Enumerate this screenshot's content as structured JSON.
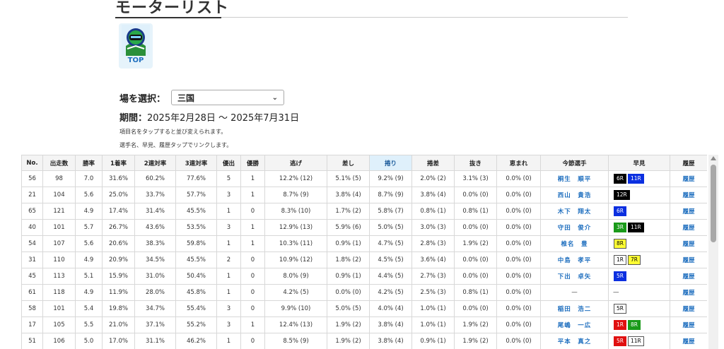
{
  "page": {
    "title": "モーターリスト"
  },
  "top_link": {
    "label": "TOP"
  },
  "venue": {
    "label": "場を選択：",
    "selected": "三国"
  },
  "period": {
    "label": "期間：",
    "value": "2025年2月28日 〜 2025年7月31日"
  },
  "notes": [
    "項目名をタップすると並び変えられます。",
    "選手名、早見、履歴タップでリンクします。"
  ],
  "table": {
    "headers": [
      "No.",
      "出走数",
      "勝率",
      "1着率",
      "2連対率",
      "3連対率",
      "優出",
      "優勝",
      "逃げ",
      "差し",
      "捲り",
      "捲差",
      "抜き",
      "恵まれ",
      "今節選手",
      "早見",
      "履歴"
    ],
    "active_header": "捲り",
    "rows": [
      {
        "no": "56",
        "starts": "98",
        "win": "7.0",
        "r1": "31.6%",
        "r2": "60.2%",
        "r3": "77.6%",
        "yu": "5",
        "yusho": "1",
        "nige": "12.2% (12)",
        "sashi": "5.1% (5)",
        "makuri": "9.2% (9)",
        "makusa": "2.0% (2)",
        "nuki": "3.1% (3)",
        "megu": "0.0% (0)",
        "racer": "桐生　順平",
        "haya": [
          {
            "t": "6R",
            "c": "black"
          },
          {
            "t": "11R",
            "c": "blue"
          }
        ],
        "hist": "履歴"
      },
      {
        "no": "21",
        "starts": "104",
        "win": "5.6",
        "r1": "25.0%",
        "r2": "33.7%",
        "r3": "57.7%",
        "yu": "3",
        "yusho": "1",
        "nige": "8.7% (9)",
        "sashi": "3.8% (4)",
        "makuri": "8.7% (9)",
        "makusa": "3.8% (4)",
        "nuki": "0.0% (0)",
        "megu": "0.0% (0)",
        "racer": "西山　貴浩",
        "haya": [
          {
            "t": "12R",
            "c": "black"
          }
        ],
        "hist": "履歴"
      },
      {
        "no": "65",
        "starts": "121",
        "win": "4.9",
        "r1": "17.4%",
        "r2": "31.4%",
        "r3": "45.5%",
        "yu": "1",
        "yusho": "0",
        "nige": "8.3% (10)",
        "sashi": "1.7% (2)",
        "makuri": "5.8% (7)",
        "makusa": "0.8% (1)",
        "nuki": "0.8% (1)",
        "megu": "0.0% (0)",
        "racer": "木下　翔太",
        "haya": [
          {
            "t": "6R",
            "c": "blue"
          }
        ],
        "hist": "履歴"
      },
      {
        "no": "40",
        "starts": "101",
        "win": "5.7",
        "r1": "26.7%",
        "r2": "43.6%",
        "r3": "53.5%",
        "yu": "3",
        "yusho": "1",
        "nige": "12.9% (13)",
        "sashi": "5.9% (6)",
        "makuri": "5.0% (5)",
        "makusa": "3.0% (3)",
        "nuki": "0.0% (0)",
        "megu": "0.0% (0)",
        "racer": "守田　俊介",
        "haya": [
          {
            "t": "3R",
            "c": "green"
          },
          {
            "t": "11R",
            "c": "black"
          }
        ],
        "hist": "履歴"
      },
      {
        "no": "54",
        "starts": "107",
        "win": "5.6",
        "r1": "20.6%",
        "r2": "38.3%",
        "r3": "59.8%",
        "yu": "1",
        "yusho": "1",
        "nige": "10.3% (11)",
        "sashi": "0.9% (1)",
        "makuri": "4.7% (5)",
        "makusa": "2.8% (3)",
        "nuki": "1.9% (2)",
        "megu": "0.0% (0)",
        "racer": "椎名　豊",
        "haya": [
          {
            "t": "8R",
            "c": "yellow"
          }
        ],
        "hist": "履歴"
      },
      {
        "no": "31",
        "starts": "110",
        "win": "4.9",
        "r1": "20.9%",
        "r2": "34.5%",
        "r3": "45.5%",
        "yu": "2",
        "yusho": "0",
        "nige": "10.9% (12)",
        "sashi": "1.8% (2)",
        "makuri": "4.5% (5)",
        "makusa": "3.6% (4)",
        "nuki": "0.0% (0)",
        "megu": "0.0% (0)",
        "racer": "中島　孝平",
        "haya": [
          {
            "t": "1R",
            "c": "white"
          },
          {
            "t": "7R",
            "c": "yellow"
          }
        ],
        "hist": "履歴"
      },
      {
        "no": "45",
        "starts": "113",
        "win": "5.1",
        "r1": "15.9%",
        "r2": "31.0%",
        "r3": "50.4%",
        "yu": "1",
        "yusho": "0",
        "nige": "8.0% (9)",
        "sashi": "0.9% (1)",
        "makuri": "4.4% (5)",
        "makusa": "2.7% (3)",
        "nuki": "0.0% (0)",
        "megu": "0.0% (0)",
        "racer": "下出　卓矢",
        "haya": [
          {
            "t": "5R",
            "c": "blue"
          }
        ],
        "hist": "履歴"
      },
      {
        "no": "61",
        "starts": "118",
        "win": "4.9",
        "r1": "11.9%",
        "r2": "28.0%",
        "r3": "45.8%",
        "yu": "1",
        "yusho": "0",
        "nige": "4.2% (5)",
        "sashi": "0.0% (0)",
        "makuri": "4.2% (5)",
        "makusa": "2.5% (3)",
        "nuki": "0.8% (1)",
        "megu": "0.0% (0)",
        "racer": "—",
        "haya": [],
        "haya_text": "—",
        "hist": "履歴"
      },
      {
        "no": "58",
        "starts": "101",
        "win": "5.4",
        "r1": "19.8%",
        "r2": "34.7%",
        "r3": "55.4%",
        "yu": "3",
        "yusho": "0",
        "nige": "9.9% (10)",
        "sashi": "5.0% (5)",
        "makuri": "4.0% (4)",
        "makusa": "1.0% (1)",
        "nuki": "0.0% (0)",
        "megu": "0.0% (0)",
        "racer": "稲田　浩二",
        "haya": [
          {
            "t": "5R",
            "c": "white"
          }
        ],
        "hist": "履歴"
      },
      {
        "no": "17",
        "starts": "105",
        "win": "5.5",
        "r1": "21.0%",
        "r2": "37.1%",
        "r3": "55.2%",
        "yu": "3",
        "yusho": "1",
        "nige": "12.4% (13)",
        "sashi": "1.9% (2)",
        "makuri": "3.8% (4)",
        "makusa": "1.0% (1)",
        "nuki": "1.9% (2)",
        "megu": "0.0% (0)",
        "racer": "尾嶋　一広",
        "haya": [
          {
            "t": "1R",
            "c": "red"
          },
          {
            "t": "8R",
            "c": "green"
          }
        ],
        "hist": "履歴"
      },
      {
        "no": "51",
        "starts": "106",
        "win": "5.0",
        "r1": "17.0%",
        "r2": "31.1%",
        "r3": "46.2%",
        "yu": "1",
        "yusho": "0",
        "nige": "8.5% (9)",
        "sashi": "1.9% (2)",
        "makuri": "3.8% (4)",
        "makusa": "0.9% (1)",
        "nuki": "1.9% (2)",
        "megu": "0.0% (0)",
        "racer": "平本　真之",
        "haya": [
          {
            "t": "5R",
            "c": "red"
          },
          {
            "t": "11R",
            "c": "white"
          }
        ],
        "hist": "履歴"
      }
    ]
  }
}
